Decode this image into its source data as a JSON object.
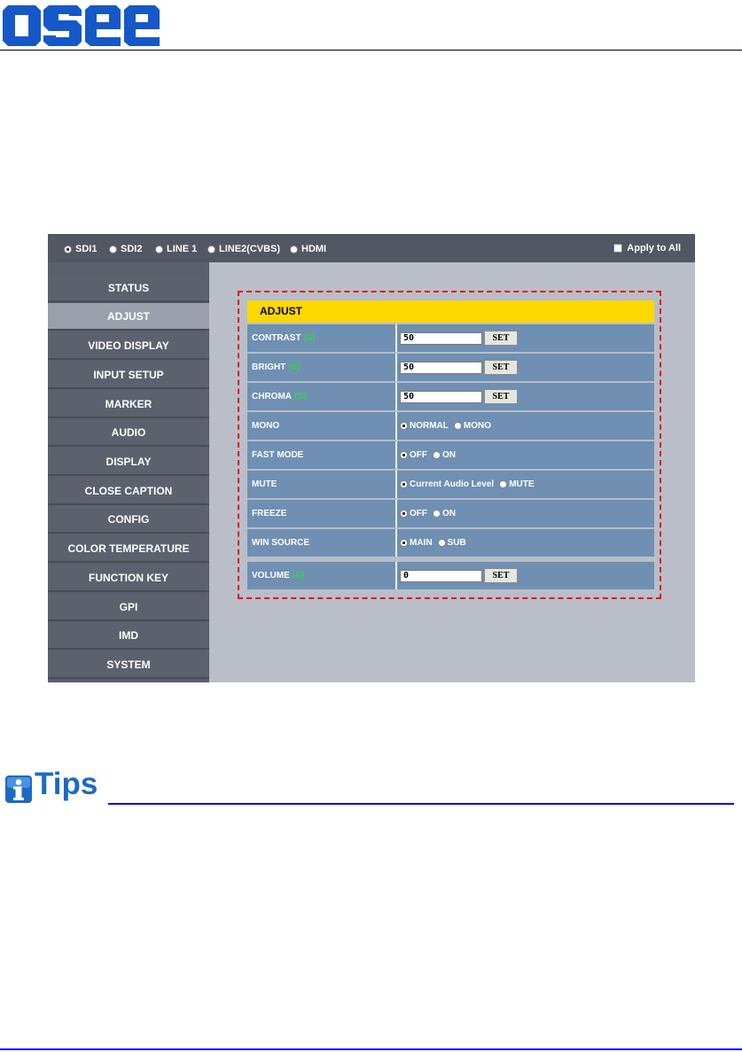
{
  "brand": {
    "logo_text": "osee"
  },
  "source_bar": {
    "sources": [
      {
        "label": "SDI1",
        "selected": true
      },
      {
        "label": "SDI2",
        "selected": false
      },
      {
        "label": "LINE 1",
        "selected": false
      },
      {
        "label": "LINE2(CVBS)",
        "selected": false
      },
      {
        "label": "HDMI",
        "selected": false
      }
    ],
    "apply_all": {
      "label": "Apply to All",
      "checked": false
    }
  },
  "sidebar": {
    "items": [
      "STATUS",
      "ADJUST",
      "VIDEO DISPLAY",
      "INPUT SETUP",
      "MARKER",
      "AUDIO",
      "DISPLAY",
      "CLOSE CAPTION",
      "CONFIG",
      "COLOR TEMPERATURE",
      "FUNCTION KEY",
      "GPI",
      "IMD",
      "SYSTEM"
    ],
    "active": "ADJUST"
  },
  "panel": {
    "title": "ADJUST",
    "set_label": "SET",
    "suffix": "(S)",
    "contrast": {
      "label": "CONTRAST",
      "value": "50"
    },
    "bright": {
      "label": "BRIGHT",
      "value": "50"
    },
    "chroma": {
      "label": "CHROMA",
      "value": "50"
    },
    "mono": {
      "label": "MONO",
      "options": [
        "NORMAL",
        "MONO"
      ],
      "selected": "NORMAL"
    },
    "fast_mode": {
      "label": "FAST MODE",
      "options": [
        "OFF",
        "ON"
      ],
      "selected": "OFF"
    },
    "mute": {
      "label": "MUTE",
      "options": [
        "Current Audio Level",
        "MUTE"
      ],
      "selected": "Current Audio Level"
    },
    "freeze": {
      "label": "FREEZE",
      "options": [
        "OFF",
        "ON"
      ],
      "selected": "OFF"
    },
    "win_source": {
      "label": "WIN SOURCE",
      "options": [
        "MAIN",
        "SUB"
      ],
      "selected": "MAIN"
    },
    "volume": {
      "label": "VOLUME",
      "value": "0"
    }
  },
  "tips": {
    "heading": "Tips"
  },
  "colors": {
    "accent_yellow": "#ffd800",
    "row_blue": "#6f8fb3",
    "dash_red": "#e2140f",
    "tips_blue": "#1d69c4"
  },
  "icons": {
    "tips": "info-icon"
  }
}
